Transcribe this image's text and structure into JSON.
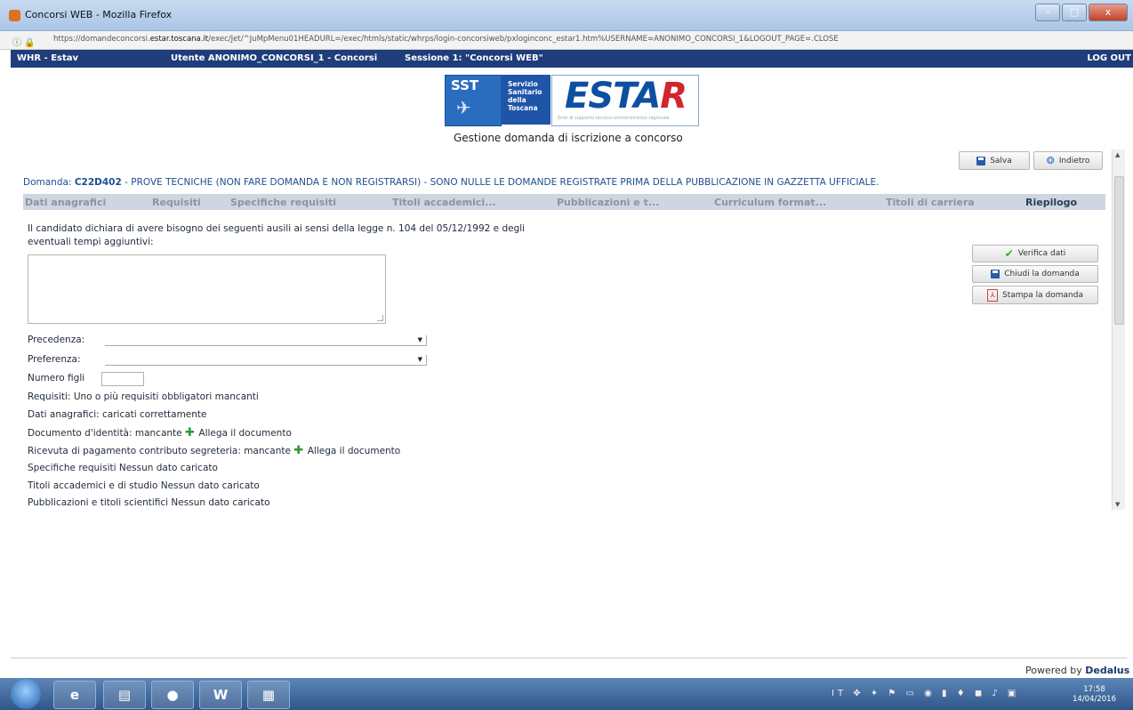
{
  "window": {
    "title": "Concorsi WEB - Mozilla Firefox",
    "buttons": [
      "–",
      "□",
      "x"
    ]
  },
  "browser": {
    "url_prefix": "https://domandeconcorsi.",
    "url_domain": "estar.toscana.it",
    "url_rest": "/exec/Jet/^JuMpMenu01HEADURL=/exec/htmls/static/whrps/login-concorsiweb/pxloginconc_estar1.htm%USERNAME=ANONIMO_CONCORSI_1&LOGOUT_PAGE=.CLOSE"
  },
  "appbar": {
    "app": "WHR - Estav",
    "user": "Utente ANONIMO_CONCORSI_1 - Concorsi",
    "session": "Sessione 1: \"Concorsi WEB\"",
    "logout": "LOG OUT"
  },
  "logo": {
    "sst": "SST",
    "servizio": [
      "Servizio",
      "Sanitario",
      "della",
      "Toscana"
    ],
    "estar_main": "ESTA",
    "estar_r": "R",
    "estar_sub": "Ente di supporto tecnico-amministrativo regionale"
  },
  "subtitle": "Gestione domanda di iscrizione a concorso",
  "toolbar": {
    "save": "Salva",
    "back": "Indietro"
  },
  "domanda": {
    "label": "Domanda:",
    "code": "C22D402",
    "text": "- PROVE TECNICHE (NON FARE DOMANDA E NON REGISTRARSI) - SONO NULLE LE DOMANDE REGISTRATE PRIMA DELLA PUBBLICAZIONE IN GAZZETTA UFFICIALE."
  },
  "tabs": [
    "Dati anagrafici",
    "Requisiti",
    "Specifiche requisiti",
    "Titoli accademici...",
    "Pubblicazioni e t...",
    "Curriculum format...",
    "Titoli di carriera",
    "Riepilogo"
  ],
  "content": {
    "ausili_line1": "Il candidato dichiara di avere bisogno dei seguenti ausili ai sensi della legge n. 104 del 05/12/1992 e degli",
    "ausili_line2": "eventuali tempi aggiuntivi:",
    "precedenza_label": "Precedenza:",
    "preferenza_label": "Preferenza:",
    "numero_figli_label": "Numero figli",
    "requisiti": "Requisiti: Uno o più requisiti obbligatori mancanti",
    "dati_anagrafici": "Dati anagrafici: caricati correttamente",
    "documento": "Documento d'identità: mancante",
    "ricevuta": "Ricevuta di pagamento contributo segreteria: mancante",
    "allega": "Allega il documento",
    "specifiche": "Specifiche requisiti Nessun dato caricato",
    "titoli": "Titoli accademici e di studio Nessun dato caricato",
    "pubblicazioni": "Pubblicazioni e titoli scientifici Nessun dato caricato"
  },
  "side_buttons": {
    "verifica": "Verifica dati",
    "chiudi": "Chiudi la domanda",
    "stampa": "Stampa la domanda"
  },
  "footer": {
    "powered": "Powered by",
    "brand": "Dedalus"
  },
  "taskbar": {
    "word": "W",
    "time": "17:58",
    "date": "14/04/2016",
    "lang": "IT"
  },
  "colors": {
    "appbar": "#1f3d7b",
    "link": "#1c4f8f",
    "tabs_bg": "#cfd6e2"
  }
}
